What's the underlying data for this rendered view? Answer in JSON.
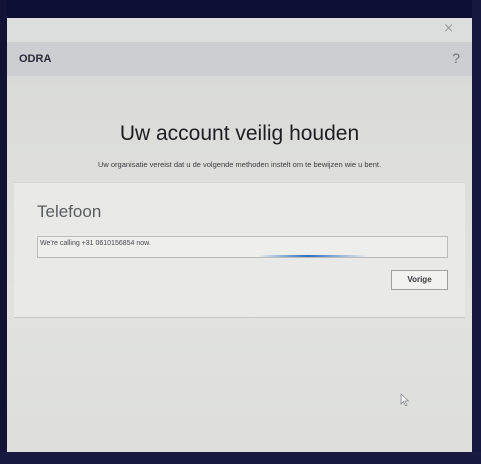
{
  "window": {
    "close_glyph": "×",
    "close_icon": "close-icon",
    "help_glyph": "?",
    "help_icon": "help-icon"
  },
  "header": {
    "org_name": "ODRA"
  },
  "main": {
    "title": "Uw account veilig houden",
    "subtitle": "Uw organisatie vereist dat u de volgende methoden instelt om te bewijzen wie u bent."
  },
  "card": {
    "title": "Telefoon",
    "status_text": "We're calling +31 0610156854 now.",
    "back_button_label": "Vorige"
  },
  "colors": {
    "background": "#e4e5e3",
    "header": "#ccced2",
    "accent": "#2b6fc0"
  }
}
